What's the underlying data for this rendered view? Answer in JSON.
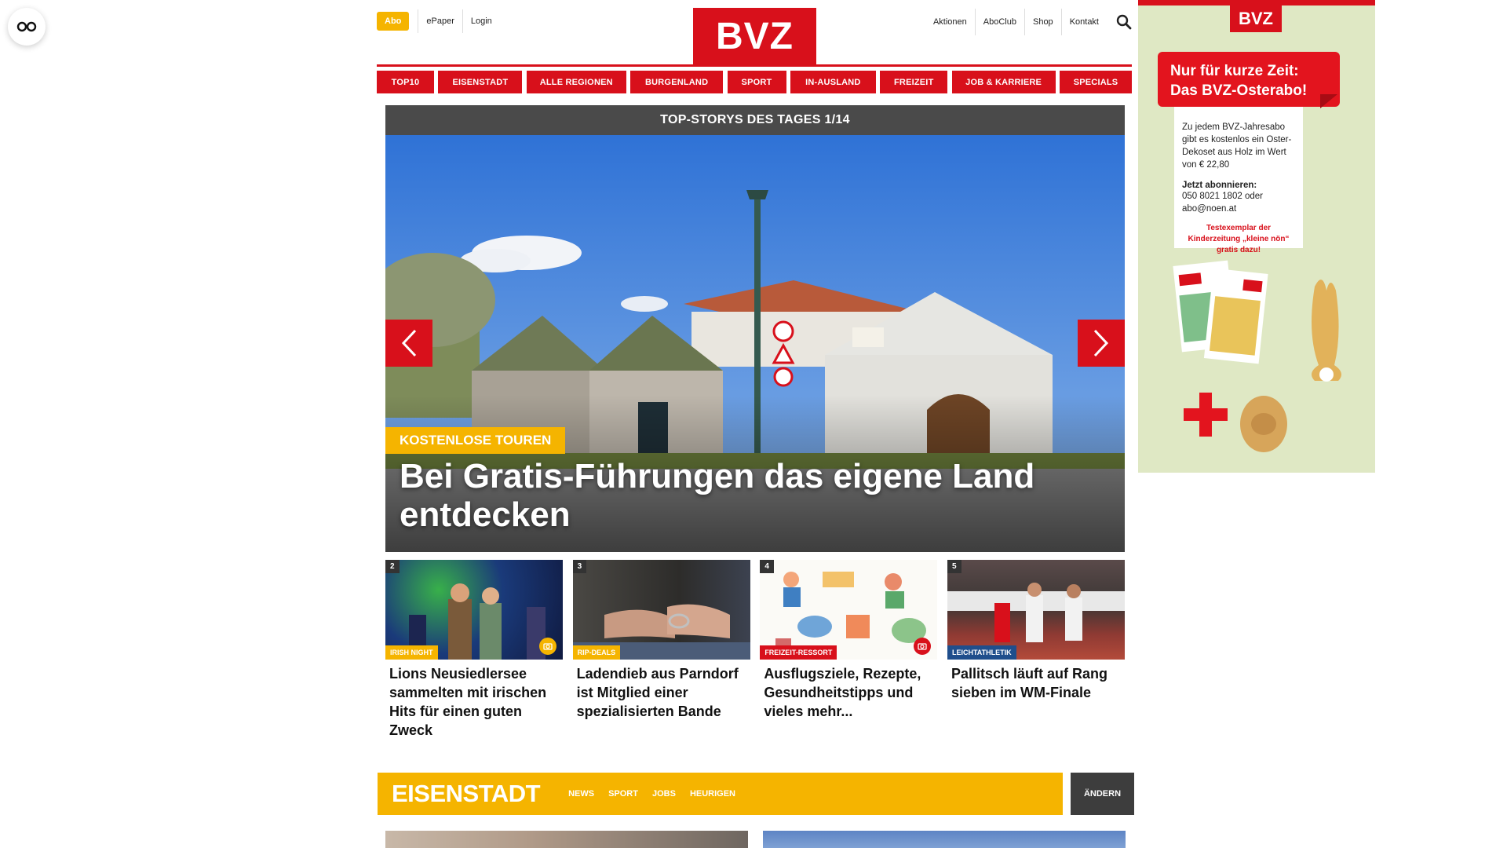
{
  "header": {
    "abo_label": "Abo",
    "left_links": [
      "ePaper",
      "Login"
    ],
    "logo_text": "BVZ",
    "right_links": [
      "Aktionen",
      "AboClub",
      "Shop",
      "Kontakt"
    ]
  },
  "nav": {
    "items": [
      "TOP10",
      "EISENSTADT",
      "ALLE REGIONEN",
      "BURGENLAND",
      "SPORT",
      "IN-AUSLAND",
      "FREIZEIT",
      "JOB & KARRIERE",
      "SPECIALS"
    ]
  },
  "hero": {
    "header": "TOP-STORYS DES TAGES 1/14",
    "kicker": "KOSTENLOSE TOUREN",
    "title": "Bei Gratis-Führungen das eigene Land entdecken"
  },
  "teasers": [
    {
      "num": "2",
      "tag": "IRISH NIGHT",
      "tag_color": "#f5b400",
      "title": "Lions Neusiedlersee sammelten mit irischen Hits für einen guten Zweck",
      "gallery": true
    },
    {
      "num": "3",
      "tag": "RIP-DEALS",
      "tag_color": "#f5b400",
      "title": "Ladendieb aus Parndorf ist Mitglied einer spezialisierten Bande",
      "gallery": false
    },
    {
      "num": "4",
      "tag": "FREIZEIT-RESSORT",
      "tag_color": "#d8101b",
      "title": "Ausflugsziele, Rezepte, Gesundheitstipps und vieles mehr...",
      "gallery": true
    },
    {
      "num": "5",
      "tag": "LEICHTATHLETIK",
      "tag_color": "#1f4e8c",
      "title": "Pallitsch läuft auf Rang sieben im WM-Finale",
      "gallery": false
    }
  ],
  "region": {
    "title": "EISENSTADT",
    "links": [
      "NEWS",
      "SPORT",
      "JOBS",
      "HEURIGEN"
    ],
    "change_label": "ÄNDERN"
  },
  "ad": {
    "logo": "BVZ",
    "headline_1": "Nur für kurze Zeit:",
    "headline_2": "Das BVZ-Osterabo!",
    "body": "Zu jedem BVZ-Jahresabo gibt es kostenlos ein Oster-Dekoset aus Holz im Wert von € 22,80",
    "cta": "Jetzt abonnieren:",
    "contact": "050 8021 1802 oder abo@noen.at",
    "promo": "Testexemplar der Kinderzeitung „kleine nön“ gratis dazu!"
  },
  "colors": {
    "brand_red": "#d8101b",
    "accent_yellow": "#f5b400",
    "dark_gray": "#4a4a4a"
  }
}
